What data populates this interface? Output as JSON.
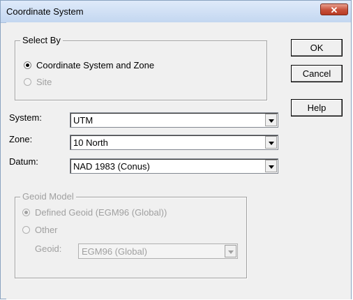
{
  "window": {
    "title": "Coordinate System",
    "close_label": "✕"
  },
  "select_by": {
    "legend": "Select By",
    "options": [
      {
        "label": "Coordinate System and Zone",
        "checked": true,
        "enabled": true
      },
      {
        "label": "Site",
        "checked": false,
        "enabled": false
      }
    ]
  },
  "buttons": {
    "ok": "OK",
    "cancel": "Cancel",
    "help": "Help"
  },
  "fields": {
    "system": {
      "label": "System:",
      "value": "UTM"
    },
    "zone": {
      "label": "Zone:",
      "value": "10 North"
    },
    "datum": {
      "label": "Datum:",
      "value": "NAD 1983 (Conus)"
    }
  },
  "geoid_model": {
    "legend": "Geoid Model",
    "options": [
      {
        "label": "Defined Geoid (EGM96 (Global))",
        "checked": true,
        "enabled": false
      },
      {
        "label": "Other",
        "checked": false,
        "enabled": false
      }
    ],
    "geoid": {
      "label": "Geoid:",
      "value": "EGM96 (Global)",
      "enabled": false
    }
  }
}
